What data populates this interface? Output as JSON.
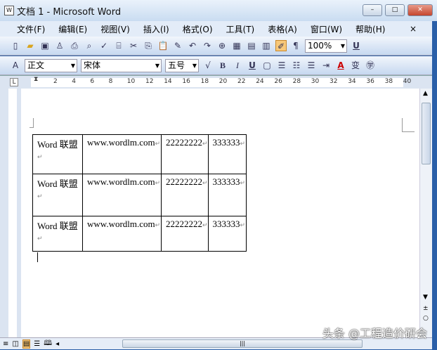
{
  "window": {
    "title": "文档 1 - Microsoft Word",
    "minimize": "–",
    "maximize": "□",
    "close": "✕"
  },
  "menu": [
    "文件(F)",
    "编辑(E)",
    "视图(V)",
    "插入(I)",
    "格式(O)",
    "工具(T)",
    "表格(A)",
    "窗口(W)",
    "帮助(H)"
  ],
  "menu_close": "×",
  "toolbar": {
    "zoom": "100%",
    "underline": "U"
  },
  "format_toolbar": {
    "style": "正文",
    "font": "宋体",
    "size": "五号",
    "bold": "B",
    "italic": "I",
    "underline": "U",
    "font_color": "A"
  },
  "ruler": [
    "2",
    "4",
    "6",
    "8",
    "10",
    "12",
    "14",
    "16",
    "18",
    "20",
    "22",
    "24",
    "26",
    "28",
    "30",
    "32",
    "34",
    "36",
    "38",
    "40"
  ],
  "table": [
    [
      "Word 联盟",
      "www.wordlm.com",
      "22222222",
      "333333"
    ],
    [
      "Word 联盟",
      "www.wordlm.com",
      "22222222",
      "333333"
    ],
    [
      "Word 联盟",
      "www.wordlm.com",
      "22222222",
      "333333"
    ]
  ],
  "cell_mark": "↵",
  "watermark": "头条 @工程造价研会"
}
